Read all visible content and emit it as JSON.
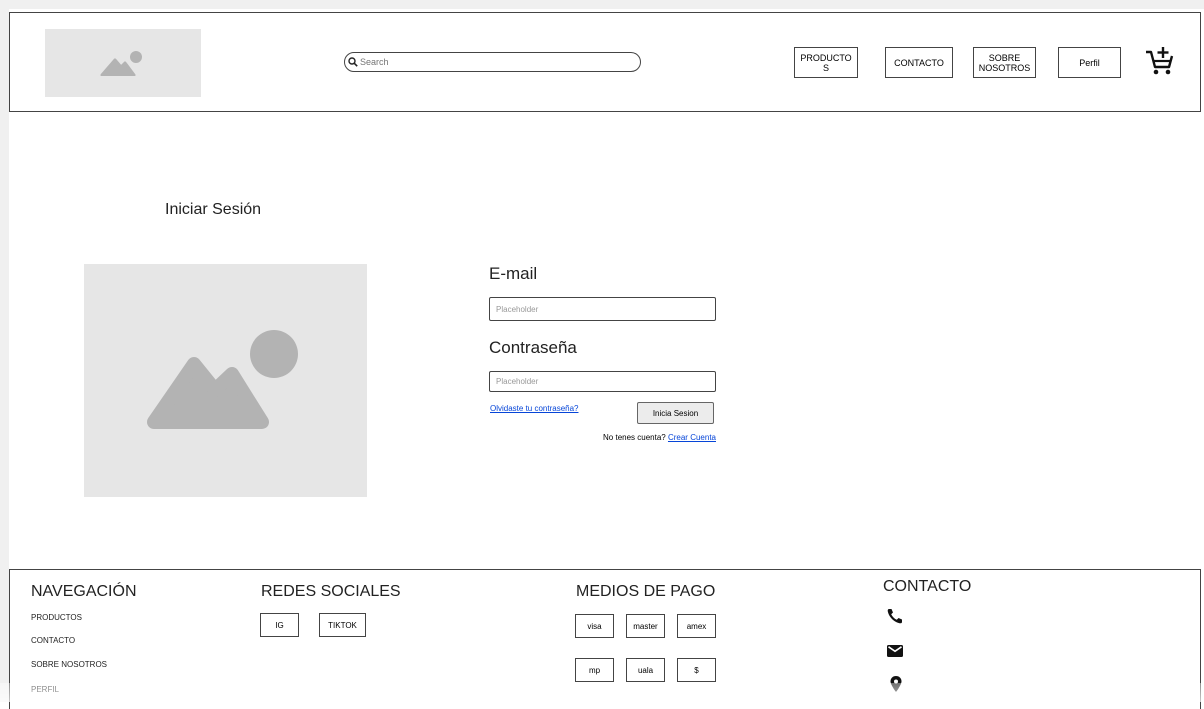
{
  "header": {
    "search_placeholder": "Search",
    "nav": [
      {
        "label": "PRODUCTO\nS"
      },
      {
        "label": "CONTACTO"
      },
      {
        "label": "SOBRE\nNOSOTROS"
      },
      {
        "label": "Perfil"
      }
    ],
    "cart_icon": "cart-add-icon"
  },
  "main": {
    "title": "Iniciar Sesión",
    "email_label": "E-mail",
    "email_placeholder": "Placeholder",
    "password_label": "Contraseña",
    "password_placeholder": "Placeholder",
    "forgot_link": "Olvidaste tu contraseña?",
    "login_button": "Inicia Sesion",
    "no_account_text": "No tenes cuenta?",
    "create_account_link": "Crear Cuenta"
  },
  "footer": {
    "nav_title": "NAVEGACIÓN",
    "nav_links": [
      "PRODUCTOS",
      "CONTACTO",
      "SOBRE NOSOTROS",
      "PERFIL"
    ],
    "social_title": "REDES SOCIALES",
    "social": [
      "IG",
      "TIKTOK"
    ],
    "payment_title": "MEDIOS DE PAGO",
    "payments_row1": [
      "visa",
      "master",
      "amex"
    ],
    "payments_row2": [
      "mp",
      "uala",
      "$"
    ],
    "contact_title": "CONTACTO",
    "contact_icons": [
      "phone-icon",
      "mail-icon",
      "location-icon"
    ]
  },
  "colors": {
    "placeholder_bg": "#e6e6e6",
    "placeholder_shape": "#b3b3b3",
    "link": "#0645d8",
    "border": "#444444"
  }
}
